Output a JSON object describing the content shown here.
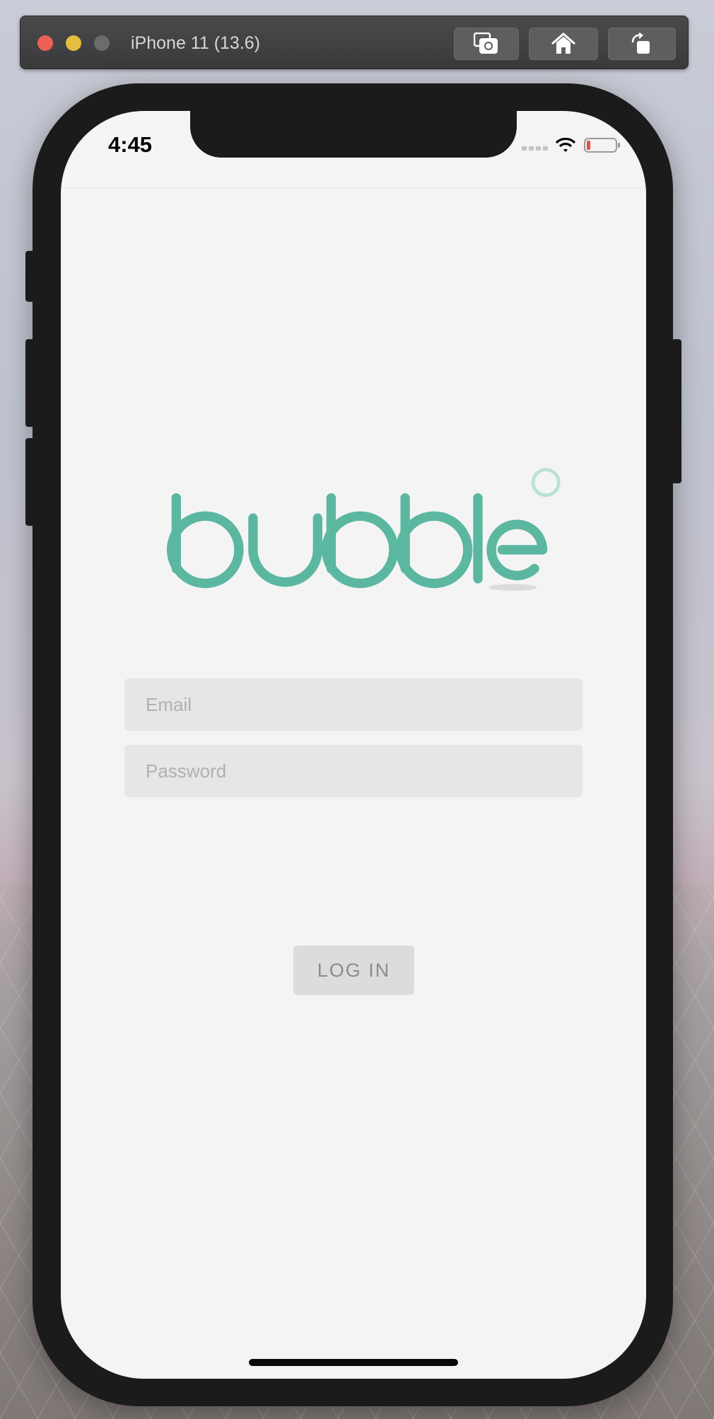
{
  "simulator": {
    "title": "iPhone 11 (13.6)",
    "buttons": [
      "screenshot-icon",
      "home-icon",
      "rotate-icon"
    ]
  },
  "status_bar": {
    "time": "4:45",
    "icons": [
      "cellular-signal-icon",
      "wifi-icon",
      "battery-low-icon"
    ]
  },
  "logo": {
    "text": "bubble"
  },
  "form": {
    "email_placeholder": "Email",
    "email_value": "",
    "password_placeholder": "Password",
    "password_value": "",
    "login_label": "LOG IN"
  },
  "colors": {
    "brand_teal": "#5bb7a0",
    "brand_teal_light": "#b8e2d8",
    "field_bg": "#e6e6e6",
    "button_bg": "#dcdcdc",
    "screen_bg": "#f4f4f4"
  }
}
